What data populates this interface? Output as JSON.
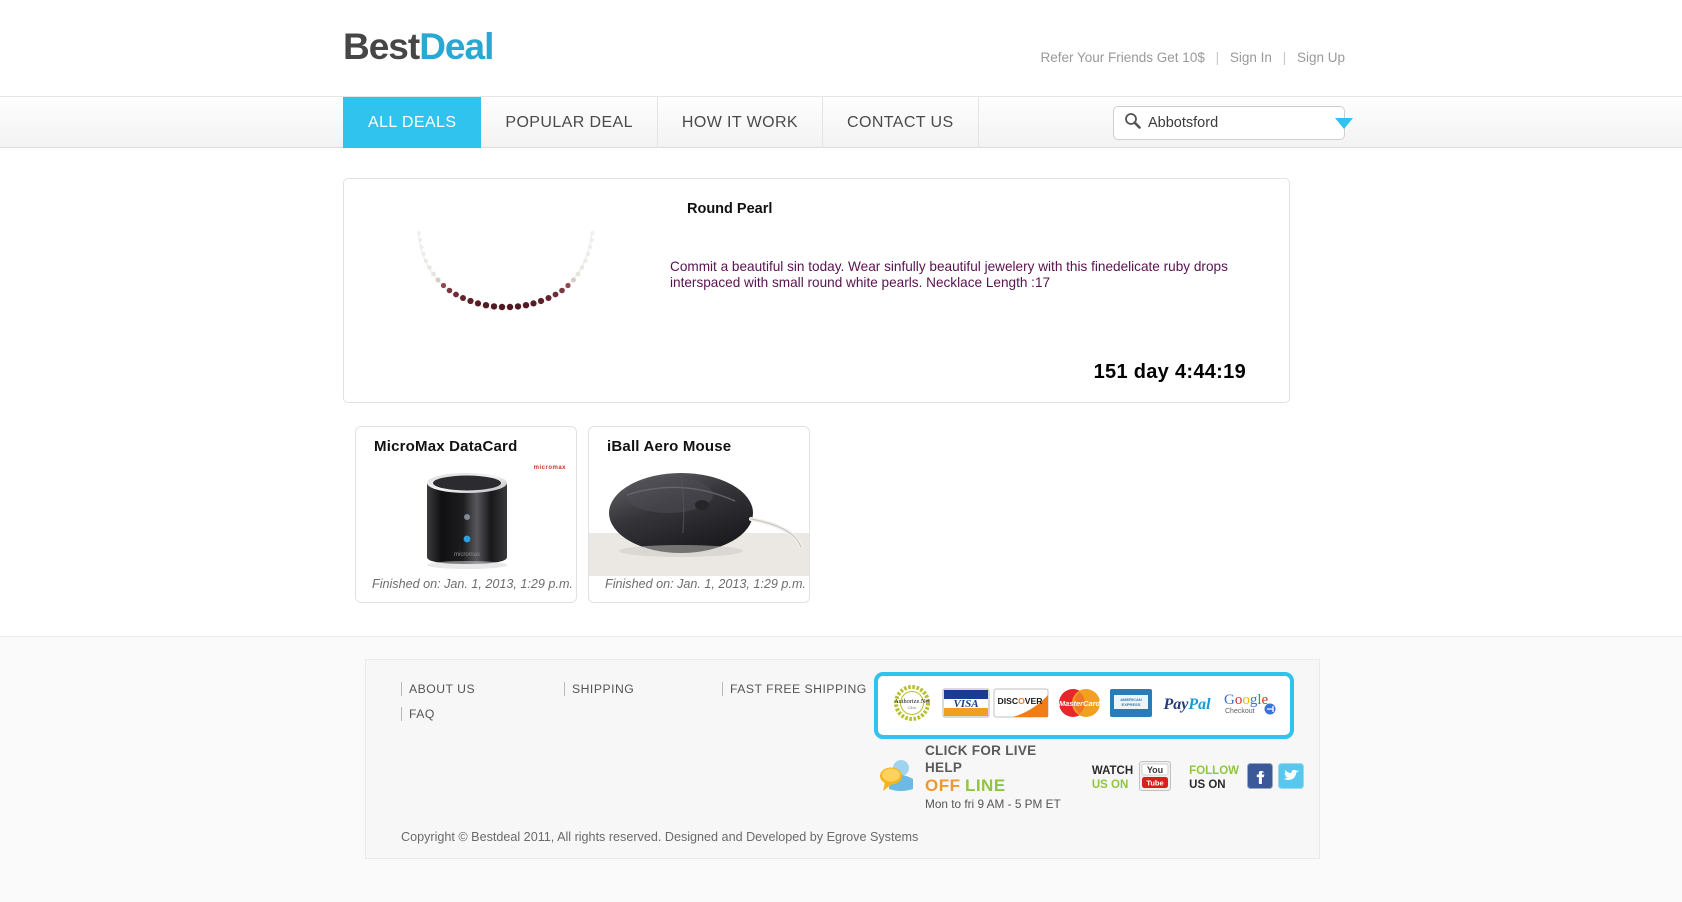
{
  "header": {
    "logo_first": "Best",
    "logo_second": "Deal",
    "toplinks": {
      "refer": "Refer Your Friends Get 10$",
      "sign_in": "Sign In",
      "sign_up": "Sign Up",
      "separator": "|"
    }
  },
  "nav": {
    "items": [
      {
        "label": "ALL DEALS",
        "active": true
      },
      {
        "label": "POPULAR DEAL",
        "active": false
      },
      {
        "label": "HOW IT WORK",
        "active": false
      },
      {
        "label": "CONTACT US",
        "active": false
      }
    ],
    "search": {
      "icon": "search-icon",
      "value": "Abbotsford",
      "placeholder": "Abbotsford",
      "caret_icon": "chevron-down-icon"
    }
  },
  "feature": {
    "title": "Round Pearl",
    "description": "Commit a beautiful sin today. Wear sinfully beautiful jewelery with this finedelicate ruby drops interspaced with small round white pearls. Necklace Length :17",
    "timer": "151 day 4:44:19",
    "image_name": "round-pearl-necklace"
  },
  "products": [
    {
      "title": "MicroMax DataCard",
      "finished": "Finished on: Jan. 1, 2013, 1:29 p.m.",
      "brand": "micromax",
      "image_name": "micromax-datacard"
    },
    {
      "title": "iBall Aero Mouse",
      "finished": "Finished on: Jan. 1, 2013, 1:29 p.m.",
      "brand": "",
      "image_name": "iball-aero-mouse"
    }
  ],
  "footer": {
    "links": [
      "ABOUT US",
      "SHIPPING",
      "FAST FREE SHIPPING",
      "FAQ"
    ],
    "payments": [
      "Authorize.Net",
      "VISA",
      "DISCOVER",
      "MasterCard",
      "American Express",
      "PayPal",
      "Google Checkout"
    ],
    "live_help": {
      "heading": "CLICK FOR LIVE HELP",
      "status_off": "OFF",
      "status_line": "LINE",
      "hours": "Mon to fri 9 AM - 5 PM ET"
    },
    "watch": {
      "line1": "WATCH",
      "line2": "US ON",
      "icon": "youtube-icon"
    },
    "follow": {
      "line1": "FOLLOW",
      "line2": "US ON",
      "icons": [
        "facebook-icon",
        "twitter-icon"
      ]
    },
    "copyright": "Copyright © Bestdeal 2011, All rights reserved. Designed and Developed by Egrove Systems"
  },
  "colors": {
    "accent": "#2fc3ee",
    "logo_dark": "#464646",
    "logo_blue": "#2aa8d4",
    "desc_purple": "#58134f",
    "off_orange": "#f0982e",
    "line_green": "#8ec63f"
  }
}
